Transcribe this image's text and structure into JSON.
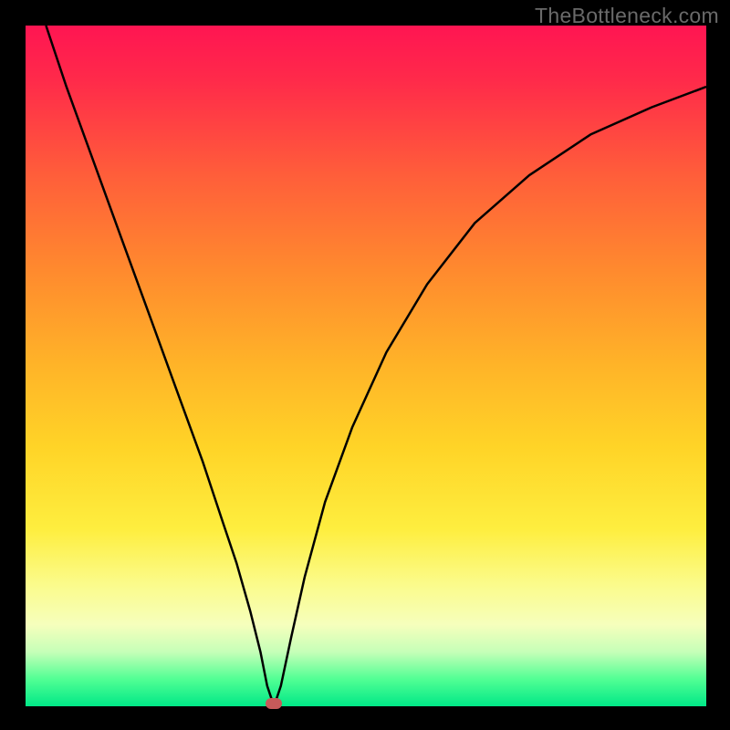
{
  "watermark": "TheBottleneck.com",
  "chart_data": {
    "type": "line",
    "title": "",
    "xlabel": "",
    "ylabel": "",
    "xlim": [
      0,
      100
    ],
    "ylim": [
      0,
      100
    ],
    "series": [
      {
        "name": "curve",
        "x": [
          3,
          6,
          10,
          14,
          18,
          22,
          26,
          29,
          31,
          33,
          34.5,
          35.5,
          36.5,
          37.5,
          39,
          41,
          44,
          48,
          53,
          59,
          66,
          74,
          83,
          92,
          100
        ],
        "y": [
          100,
          91,
          80,
          69,
          58,
          47,
          36,
          27,
          21,
          14,
          8,
          3,
          0,
          3,
          10,
          19,
          30,
          41,
          52,
          62,
          71,
          78,
          84,
          88,
          91
        ]
      }
    ],
    "marker": {
      "x": 36.5,
      "y": 0
    },
    "gradient_stops": [
      {
        "pos": 0,
        "color": "#ff1552"
      },
      {
        "pos": 50,
        "color": "#ffb428"
      },
      {
        "pos": 82,
        "color": "#fbfb8a"
      },
      {
        "pos": 100,
        "color": "#00e887"
      }
    ]
  }
}
